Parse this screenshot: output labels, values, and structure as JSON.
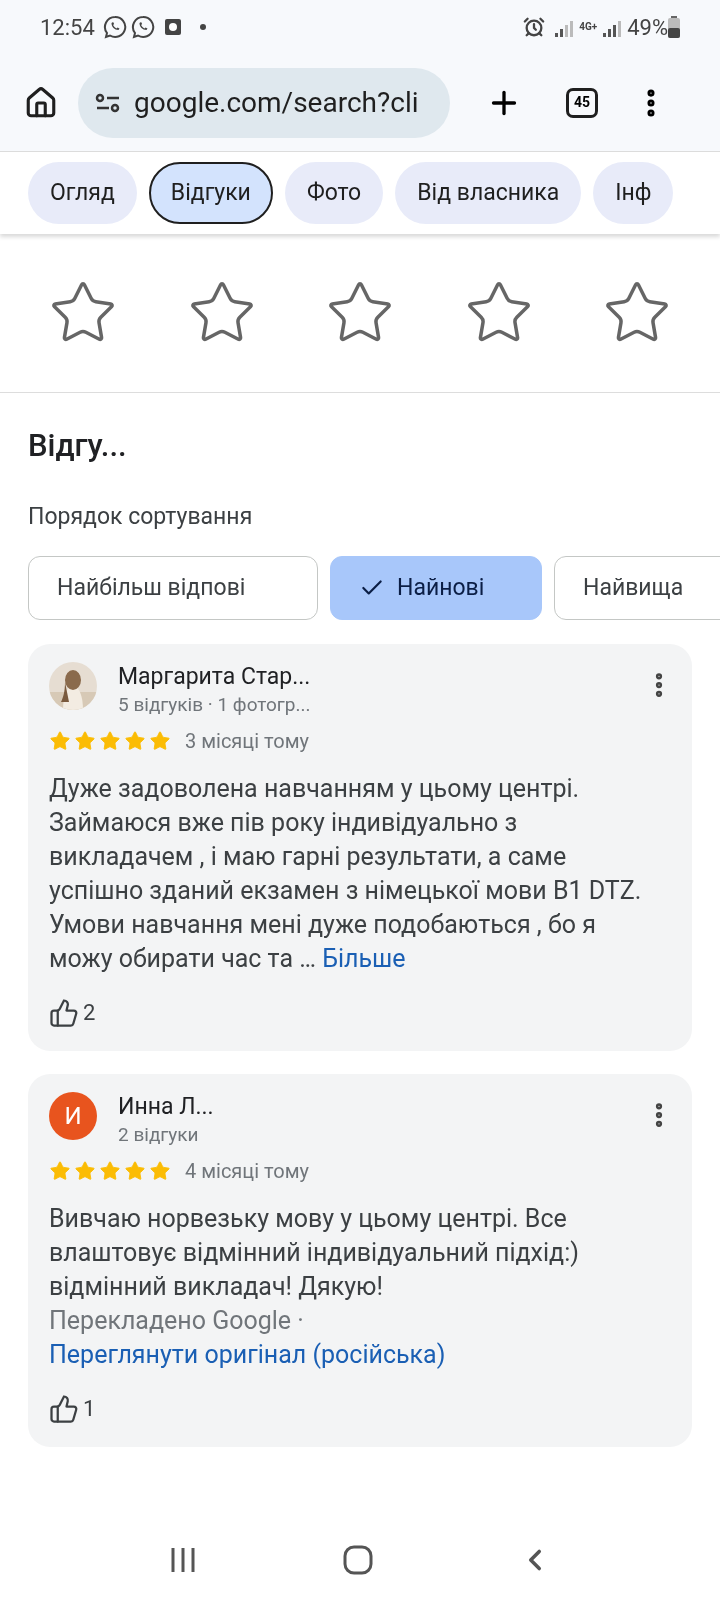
{
  "status_bar": {
    "time": "12:54",
    "network": "4G+",
    "battery": "49%"
  },
  "browser": {
    "url": "google.com/search?cli",
    "tab_count": "45"
  },
  "tabs": [
    {
      "label": "Огляд",
      "selected": false
    },
    {
      "label": "Відгуки",
      "selected": true
    },
    {
      "label": "Фото",
      "selected": false
    },
    {
      "label": "Від власника",
      "selected": false
    },
    {
      "label": "Інф",
      "selected": false
    }
  ],
  "rate": {
    "stars": 0
  },
  "reviews_section": {
    "title": "Відгу...",
    "sort_label": "Порядок сортування",
    "sort_options": [
      {
        "label": "Найбільш відпові",
        "selected": false
      },
      {
        "label": "Найнові",
        "selected": true
      },
      {
        "label": "Найвища",
        "selected": false
      }
    ]
  },
  "reviews": [
    {
      "name": "Маргарита Стар...",
      "meta": "5 відгуків · 1 фотогр...",
      "stars": 5,
      "time": "3 місяці тому",
      "text": "Дуже задоволена навчанням у цьому центрі. Займаюся вже пів року індивідуально з викладачем , і маю гарні результати, а саме успішно зданий екзамен з німецької мови B1 DTZ. Умови навчання мені дуже подобаються , бо я можу обирати час та …",
      "more": "Більше",
      "likes": "2"
    },
    {
      "avatar": {
        "kind": "letter",
        "letter": "И",
        "color": "#e8541e"
      },
      "name": "Инна Л...",
      "meta": "2 відгуки",
      "stars": 5,
      "time": "4 місяці тому",
      "text": "Вивчаю норвезьку мову у цьому центрі. Все влаштовує відмінний індивідуальний підхід:) відмінний викладач! Дякую!",
      "translated": "Перекладено Google",
      "separator": "·",
      "original_link": "Переглянути оригінал (російська)",
      "likes": "1"
    }
  ]
}
